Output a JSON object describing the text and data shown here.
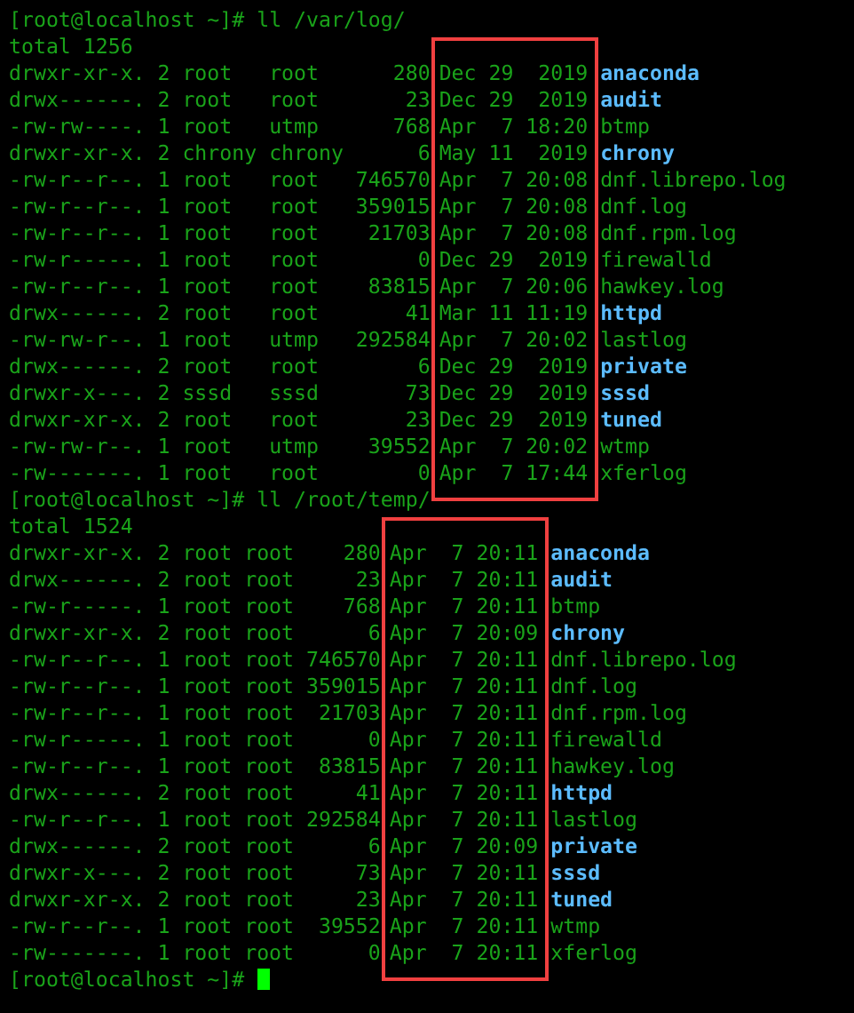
{
  "listings": [
    {
      "prompt": "[root@localhost ~]# ll /var/log/",
      "total": "total 1256",
      "entries": [
        {
          "perms": "drwxr-xr-x.",
          "links": "2",
          "owner": "root",
          "group": "root",
          "size": "280",
          "date": "Dec 29  2019",
          "name": "anaconda",
          "kind": "dir"
        },
        {
          "perms": "drwx------.",
          "links": "2",
          "owner": "root",
          "group": "root",
          "size": "23",
          "date": "Dec 29  2019",
          "name": "audit",
          "kind": "dir"
        },
        {
          "perms": "-rw-rw----.",
          "links": "1",
          "owner": "root",
          "group": "utmp",
          "size": "768",
          "date": "Apr  7 18:20",
          "name": "btmp",
          "kind": "file"
        },
        {
          "perms": "drwxr-xr-x.",
          "links": "2",
          "owner": "chrony",
          "group": "chrony",
          "size": "6",
          "date": "May 11  2019",
          "name": "chrony",
          "kind": "dir"
        },
        {
          "perms": "-rw-r--r--.",
          "links": "1",
          "owner": "root",
          "group": "root",
          "size": "746570",
          "date": "Apr  7 20:08",
          "name": "dnf.librepo.log",
          "kind": "file"
        },
        {
          "perms": "-rw-r--r--.",
          "links": "1",
          "owner": "root",
          "group": "root",
          "size": "359015",
          "date": "Apr  7 20:08",
          "name": "dnf.log",
          "kind": "file"
        },
        {
          "perms": "-rw-r--r--.",
          "links": "1",
          "owner": "root",
          "group": "root",
          "size": "21703",
          "date": "Apr  7 20:08",
          "name": "dnf.rpm.log",
          "kind": "file"
        },
        {
          "perms": "-rw-r-----.",
          "links": "1",
          "owner": "root",
          "group": "root",
          "size": "0",
          "date": "Dec 29  2019",
          "name": "firewalld",
          "kind": "file"
        },
        {
          "perms": "-rw-r--r--.",
          "links": "1",
          "owner": "root",
          "group": "root",
          "size": "83815",
          "date": "Apr  7 20:06",
          "name": "hawkey.log",
          "kind": "file"
        },
        {
          "perms": "drwx------.",
          "links": "2",
          "owner": "root",
          "group": "root",
          "size": "41",
          "date": "Mar 11 11:19",
          "name": "httpd",
          "kind": "dir"
        },
        {
          "perms": "-rw-rw-r--.",
          "links": "1",
          "owner": "root",
          "group": "utmp",
          "size": "292584",
          "date": "Apr  7 20:02",
          "name": "lastlog",
          "kind": "file"
        },
        {
          "perms": "drwx------.",
          "links": "2",
          "owner": "root",
          "group": "root",
          "size": "6",
          "date": "Dec 29  2019",
          "name": "private",
          "kind": "dir"
        },
        {
          "perms": "drwxr-x---.",
          "links": "2",
          "owner": "sssd",
          "group": "sssd",
          "size": "73",
          "date": "Dec 29  2019",
          "name": "sssd",
          "kind": "dir"
        },
        {
          "perms": "drwxr-xr-x.",
          "links": "2",
          "owner": "root",
          "group": "root",
          "size": "23",
          "date": "Dec 29  2019",
          "name": "tuned",
          "kind": "dir"
        },
        {
          "perms": "-rw-rw-r--.",
          "links": "1",
          "owner": "root",
          "group": "utmp",
          "size": "39552",
          "date": "Apr  7 20:02",
          "name": "wtmp",
          "kind": "file"
        },
        {
          "perms": "-rw-------.",
          "links": "1",
          "owner": "root",
          "group": "root",
          "size": "0",
          "date": "Apr  7 17:44",
          "name": "xferlog",
          "kind": "file"
        }
      ]
    },
    {
      "prompt": "[root@localhost ~]# ll /root/temp/",
      "total": "total 1524",
      "entries": [
        {
          "perms": "drwxr-xr-x.",
          "links": "2",
          "owner": "root",
          "group": "root",
          "size": "280",
          "date": "Apr  7 20:11",
          "name": "anaconda",
          "kind": "dir"
        },
        {
          "perms": "drwx------.",
          "links": "2",
          "owner": "root",
          "group": "root",
          "size": "23",
          "date": "Apr  7 20:11",
          "name": "audit",
          "kind": "dir"
        },
        {
          "perms": "-rw-r-----.",
          "links": "1",
          "owner": "root",
          "group": "root",
          "size": "768",
          "date": "Apr  7 20:11",
          "name": "btmp",
          "kind": "file"
        },
        {
          "perms": "drwxr-xr-x.",
          "links": "2",
          "owner": "root",
          "group": "root",
          "size": "6",
          "date": "Apr  7 20:09",
          "name": "chrony",
          "kind": "dir"
        },
        {
          "perms": "-rw-r--r--.",
          "links": "1",
          "owner": "root",
          "group": "root",
          "size": "746570",
          "date": "Apr  7 20:11",
          "name": "dnf.librepo.log",
          "kind": "file"
        },
        {
          "perms": "-rw-r--r--.",
          "links": "1",
          "owner": "root",
          "group": "root",
          "size": "359015",
          "date": "Apr  7 20:11",
          "name": "dnf.log",
          "kind": "file"
        },
        {
          "perms": "-rw-r--r--.",
          "links": "1",
          "owner": "root",
          "group": "root",
          "size": "21703",
          "date": "Apr  7 20:11",
          "name": "dnf.rpm.log",
          "kind": "file"
        },
        {
          "perms": "-rw-r-----.",
          "links": "1",
          "owner": "root",
          "group": "root",
          "size": "0",
          "date": "Apr  7 20:11",
          "name": "firewalld",
          "kind": "file"
        },
        {
          "perms": "-rw-r--r--.",
          "links": "1",
          "owner": "root",
          "group": "root",
          "size": "83815",
          "date": "Apr  7 20:11",
          "name": "hawkey.log",
          "kind": "file"
        },
        {
          "perms": "drwx------.",
          "links": "2",
          "owner": "root",
          "group": "root",
          "size": "41",
          "date": "Apr  7 20:11",
          "name": "httpd",
          "kind": "dir"
        },
        {
          "perms": "-rw-r--r--.",
          "links": "1",
          "owner": "root",
          "group": "root",
          "size": "292584",
          "date": "Apr  7 20:11",
          "name": "lastlog",
          "kind": "file"
        },
        {
          "perms": "drwx------.",
          "links": "2",
          "owner": "root",
          "group": "root",
          "size": "6",
          "date": "Apr  7 20:09",
          "name": "private",
          "kind": "dir"
        },
        {
          "perms": "drwxr-x---.",
          "links": "2",
          "owner": "root",
          "group": "root",
          "size": "73",
          "date": "Apr  7 20:11",
          "name": "sssd",
          "kind": "dir"
        },
        {
          "perms": "drwxr-xr-x.",
          "links": "2",
          "owner": "root",
          "group": "root",
          "size": "23",
          "date": "Apr  7 20:11",
          "name": "tuned",
          "kind": "dir"
        },
        {
          "perms": "-rw-r--r--.",
          "links": "1",
          "owner": "root",
          "group": "root",
          "size": "39552",
          "date": "Apr  7 20:11",
          "name": "wtmp",
          "kind": "file"
        },
        {
          "perms": "-rw-------.",
          "links": "1",
          "owner": "root",
          "group": "root",
          "size": "0",
          "date": "Apr  7 20:11",
          "name": "xferlog",
          "kind": "file"
        }
      ]
    }
  ],
  "final_prompt": "[root@localhost ~]#"
}
